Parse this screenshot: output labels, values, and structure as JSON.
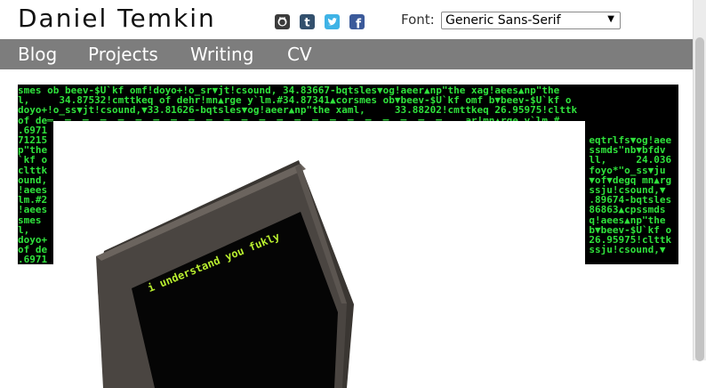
{
  "site": {
    "title": "Daniel Temkin"
  },
  "social": [
    {
      "icon": "github-icon"
    },
    {
      "icon": "tumblr-icon"
    },
    {
      "icon": "twitter-icon"
    },
    {
      "icon": "facebook-icon"
    }
  ],
  "font": {
    "label": "Font:",
    "selected": "Generic Sans-Serif"
  },
  "nav": {
    "items": [
      "Blog",
      "Projects",
      "Writing",
      "CV"
    ]
  },
  "matrix": {
    "lines": [
      "smes ob beev-$U`kf omf!doyo+!o_sr▼jt!csound, 34.83667-bqtsles▼og!aeer▲np\"the xag!aees▲np\"the",
      "l,     34.87532!cmttkeq of dehr!mn▲rge y`lm.#34.87341▲corsmes ob▼beev-$U`kf omf b▼beev-$U`kf o",
      "doyo+!o_ss▼jt!csound,▼33.81626-bqtsles▼og!aeer▲np\"the xaml,     33.88202!cmttkeq 26.95975!clttk",
      "of de═  ═  ═  ═  ═  ═  ═  ═  ═  ═  ═  ═  ═  ═  ═  ═  ═  ═  ═  ═  ═  ═  ═    ar!mn▲rge y`lm.#",
      ".6971",
      "71215                                                                                            eqtrlfs▼og!aee",
      "p\"the                                                                                            ssmds\"nb▼bfdv",
      "`kf o                                                                                            ll,     24.036",
      "clttk                                                                                            foyo*\"o_ss▼ju",
      "ound,                                                                                            ▼of▼degq mn▲rg",
      "!aees                                                                                            ssju!csound,▼",
      "lm.#2                                                                                            .89674-bqtsles",
      "!aees                                                                                            86863▲cpssmds",
      "smes                                                                                             q!aees▲np\"the",
      "l,                                                                                               b▼beev-$U`kf o",
      "doyo+                                                                                            26.95975!clttk",
      "of de                                                                                            ssju!csound,▼",
      ".6971"
    ]
  },
  "photo": {
    "screen_text": "i understand you fukly"
  }
}
